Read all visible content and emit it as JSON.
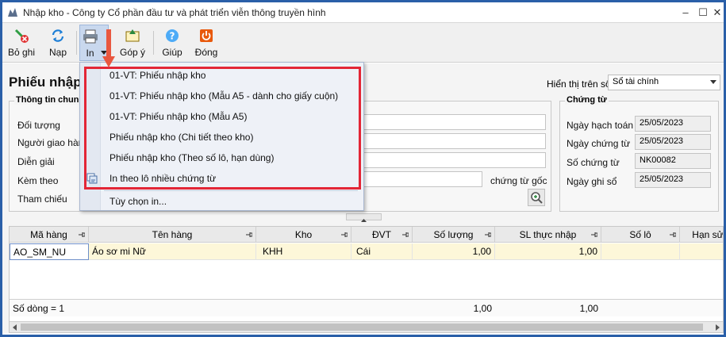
{
  "window": {
    "title": "Nhập kho - Công ty Cổ phần đầu tư và phát triển viễn thông truyền hình"
  },
  "toolbar": {
    "bo_ghi": "Bỏ ghi",
    "nap": "Nạp",
    "in": "In",
    "gop_y": "Góp ý",
    "giup": "Giúp",
    "dong": "Đóng"
  },
  "header": {
    "page_title": "Phiếu nhập",
    "hien_thi_label": "Hiển thị trên sổ",
    "hien_thi_value": "Sổ tài chính"
  },
  "general": {
    "group_title": "Thông tin chun",
    "doi_tuong": "Đối tượng",
    "nguoi_giao_hang": "Người giao hàng",
    "dien_giai": "Diễn giải",
    "kem_theo": "Kèm theo",
    "tham_chieu": "Tham chiếu",
    "chung_tu_goc": "chứng từ gốc"
  },
  "voucher": {
    "group_title": "Chứng từ",
    "ngay_hach_toan_label": "Ngày hạch toán",
    "ngay_hach_toan": "25/05/2023",
    "ngay_chung_tu_label": "Ngày chứng từ",
    "ngay_chung_tu": "25/05/2023",
    "so_chung_tu_label": "Số chứng từ",
    "so_chung_tu": "NK00082",
    "ngay_ghi_so_label": "Ngày ghi sổ",
    "ngay_ghi_so": "25/05/2023"
  },
  "grid": {
    "columns": [
      "Mã hàng",
      "Tên hàng",
      "Kho",
      "ĐVT",
      "Số lượng",
      "SL thực nhập",
      "Số lô",
      "Hạn sử"
    ],
    "rows": [
      {
        "ma_hang": "AO_SM_NU",
        "ten_hang": "Áo sơ mi Nữ",
        "kho": "KHH",
        "dvt": "Cái",
        "so_luong": "1,00",
        "sl_thuc_nhap": "1,00"
      }
    ],
    "footer": {
      "so_dong": "Số dòng = 1",
      "tong_so_luong": "1,00",
      "tong_sl_thuc_nhap": "1,00"
    }
  },
  "print_menu": {
    "items": [
      "01-VT: Phiếu nhập kho",
      "01-VT: Phiếu nhập kho (Mẫu A5 - dành cho giấy cuộn)",
      "01-VT: Phiếu nhập kho (Mẫu A5)",
      "Phiếu nhập kho (Chi tiết theo kho)",
      "Phiếu nhập kho (Theo số lô, hạn dùng)",
      "In theo lô nhiều chứng từ"
    ],
    "options": "Tùy chọn in..."
  },
  "colors": {
    "highlight_border": "#e32636",
    "window_border": "#2a5fa8",
    "selected_row": "#fdf7d9"
  }
}
